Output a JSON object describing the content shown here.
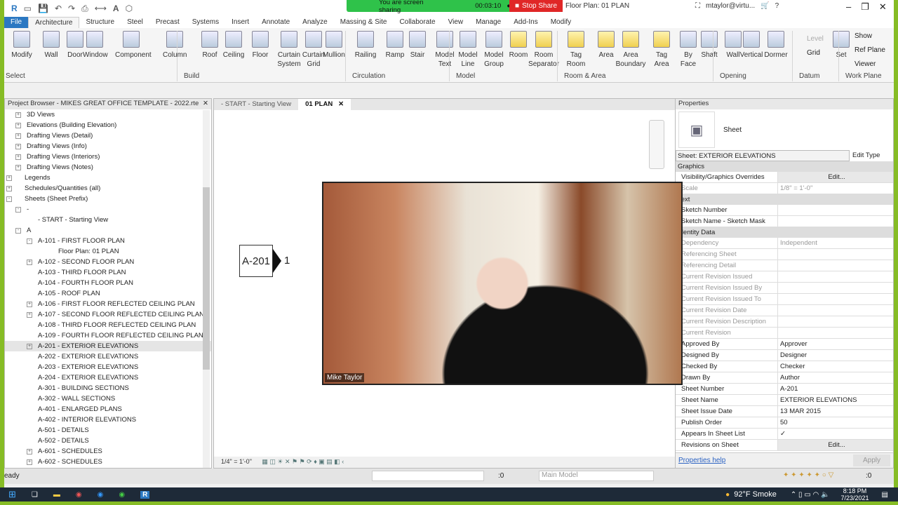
{
  "qat": {
    "title": "Floor Plan: 01 PLAN",
    "user": "mtaylor@virtu..."
  },
  "share": {
    "text": "You are screen sharing",
    "timer": "00:03:10",
    "stop": "Stop Share"
  },
  "tabs": [
    "File",
    "Architecture",
    "Structure",
    "Steel",
    "Precast",
    "Systems",
    "Insert",
    "Annotate",
    "Analyze",
    "Massing & Site",
    "Collaborate",
    "View",
    "Manage",
    "Add-Ins",
    "Modify"
  ],
  "ribbon": {
    "buttons": [
      [
        "Modify",
        8
      ],
      [
        "Wall",
        50
      ],
      [
        "Door",
        84
      ],
      [
        "Window",
        112
      ],
      [
        "Component",
        158
      ],
      [
        "Column",
        226
      ],
      [
        "Roof",
        276
      ],
      [
        "Ceiling",
        310
      ],
      [
        "Floor",
        348
      ],
      [
        "Curtain System",
        383
      ],
      [
        "Curtain Grid",
        418
      ],
      [
        "Mullion",
        453
      ],
      [
        "Railing",
        498
      ],
      [
        "Ramp",
        540
      ],
      [
        "Stair",
        572
      ],
      [
        "Model Text",
        605
      ],
      [
        "Model Line",
        638
      ],
      [
        "Model Group",
        675
      ],
      [
        "Room",
        716
      ],
      [
        "Room Separator",
        746
      ],
      [
        "Tag Room",
        798
      ],
      [
        "Area",
        841
      ],
      [
        "Area Boundary",
        870
      ],
      [
        "Tag Area",
        920
      ],
      [
        "By Face",
        958
      ],
      [
        "Shaft",
        988
      ],
      [
        "Wall",
        1022
      ],
      [
        "Vertical",
        1048
      ],
      [
        "Dormer",
        1083
      ],
      [
        "Set",
        1176
      ]
    ],
    "side": [
      "Level",
      "Grid",
      "Show",
      "Ref Plane",
      "Viewer"
    ],
    "groups": [
      [
        "Select",
        0
      ],
      [
        "Build",
        254
      ],
      [
        "Circulation",
        494
      ],
      [
        "Model",
        642
      ],
      [
        "Room & Area",
        796
      ],
      [
        "Opening",
        1018
      ],
      [
        "Datum",
        1131
      ],
      [
        "Work Plane",
        1197
      ]
    ]
  },
  "browser": {
    "title": "Project Browser - MIKES GREAT OFFICE TEMPLATE - 2022.rte",
    "items": [
      [
        "3D Views",
        1,
        "+"
      ],
      [
        "Elevations (Building Elevation)",
        1,
        "+"
      ],
      [
        "Drafting Views (Detail)",
        1,
        "+"
      ],
      [
        "Drafting Views (Info)",
        1,
        "+"
      ],
      [
        "Drafting Views (Interiors)",
        1,
        "+"
      ],
      [
        "Drafting Views (Notes)",
        1,
        "+"
      ],
      [
        "Legends",
        0,
        "+"
      ],
      [
        "Schedules/Quantities (all)",
        0,
        "+"
      ],
      [
        "Sheets (Sheet Prefix)",
        0,
        "-"
      ],
      [
        "-",
        1,
        "-"
      ],
      [
        "- START - Starting View",
        2,
        ""
      ],
      [
        "A",
        1,
        "-"
      ],
      [
        "A-101 - FIRST FLOOR PLAN",
        2,
        "-"
      ],
      [
        "Floor Plan: 01 PLAN",
        3,
        ""
      ],
      [
        "A-102 - SECOND FLOOR PLAN",
        2,
        "+"
      ],
      [
        "A-103 - THIRD FLOOR PLAN",
        2,
        ""
      ],
      [
        "A-104 - FOURTH FLOOR PLAN",
        2,
        ""
      ],
      [
        "A-105 - ROOF PLAN",
        2,
        ""
      ],
      [
        "A-106 - FIRST FLOOR REFLECTED CEILING PLAN",
        2,
        "+"
      ],
      [
        "A-107 - SECOND FLOOR REFLECTED CEILING PLAN",
        2,
        "+"
      ],
      [
        "A-108 - THIRD FLOOR REFLECTED CEILING PLAN",
        2,
        ""
      ],
      [
        "A-109 - FOURTH FLOOR REFLECTED CEILING PLAN",
        2,
        ""
      ],
      [
        "A-201 - EXTERIOR ELEVATIONS",
        2,
        "+"
      ],
      [
        "A-202 - EXTERIOR ELEVATIONS",
        2,
        ""
      ],
      [
        "A-203 - EXTERIOR ELEVATIONS",
        2,
        ""
      ],
      [
        "A-204 - EXTERIOR ELEVATIONS",
        2,
        ""
      ],
      [
        "A-301 - BUILDING SECTIONS",
        2,
        ""
      ],
      [
        "A-302 - WALL SECTIONS",
        2,
        ""
      ],
      [
        "A-401 - ENLARGED PLANS",
        2,
        ""
      ],
      [
        "A-402 - INTERIOR ELEVATIONS",
        2,
        ""
      ],
      [
        "A-501 - DETAILS",
        2,
        ""
      ],
      [
        "A-502 - DETAILS",
        2,
        ""
      ],
      [
        "A-601 - SCHEDULES",
        2,
        "+"
      ],
      [
        "A-602 - SCHEDULES",
        2,
        "+"
      ]
    ]
  },
  "view": {
    "tabs": [
      "- START - Starting View",
      "01 PLAN"
    ],
    "tag": "A-201",
    "tag_num": "1",
    "scale": "1/4\" = 1'-0\""
  },
  "video": {
    "name": "Mike Taylor"
  },
  "props": {
    "title": "Properties",
    "type": "Sheet",
    "selector": "Sheet: EXTERIOR ELEVATIONS",
    "edit_type": "Edit Type",
    "help": "Properties help",
    "apply": "Apply",
    "rows": [
      [
        "c",
        "Graphics"
      ],
      [
        "r",
        "Visibility/Graphics Overrides",
        "Edit...",
        0
      ],
      [
        "r",
        "Scale",
        "1/8\" = 1'-0\"",
        1
      ],
      [
        "c",
        "Text"
      ],
      [
        "r",
        "Sketch Number",
        "",
        0
      ],
      [
        "r",
        "Sketch Name - Sketch Mask",
        "",
        0
      ],
      [
        "c",
        "Identity Data"
      ],
      [
        "r",
        "Dependency",
        "Independent",
        1
      ],
      [
        "r",
        "Referencing Sheet",
        "",
        1
      ],
      [
        "r",
        "Referencing Detail",
        "",
        1
      ],
      [
        "r",
        "Current Revision Issued",
        "",
        1
      ],
      [
        "r",
        "Current Revision Issued By",
        "",
        1
      ],
      [
        "r",
        "Current Revision Issued To",
        "",
        1
      ],
      [
        "r",
        "Current Revision Date",
        "",
        1
      ],
      [
        "r",
        "Current Revision Description",
        "",
        1
      ],
      [
        "r",
        "Current Revision",
        "",
        1
      ],
      [
        "r",
        "Approved By",
        "Approver",
        0
      ],
      [
        "r",
        "Designed By",
        "Designer",
        0
      ],
      [
        "r",
        "Checked By",
        "Checker",
        0
      ],
      [
        "r",
        "Drawn By",
        "Author",
        0
      ],
      [
        "r",
        "Sheet Number",
        "A-201",
        0
      ],
      [
        "r",
        "Sheet Name",
        "EXTERIOR ELEVATIONS",
        0
      ],
      [
        "r",
        "Sheet Issue Date",
        "13 MAR 2015",
        0
      ],
      [
        "r",
        "Publish Order",
        "50",
        0
      ],
      [
        "r",
        "Appears In Sheet List",
        "✓",
        0
      ],
      [
        "r",
        "Revisions on Sheet",
        "Edit...",
        0
      ]
    ]
  },
  "status": {
    "left": "eady",
    "workset_count": ":0",
    "model": "Main Model",
    "filter_count": ":0"
  },
  "taskbar": {
    "weather": "92°F  Smoke",
    "time": "8:18 PM",
    "date": "7/23/2021"
  }
}
